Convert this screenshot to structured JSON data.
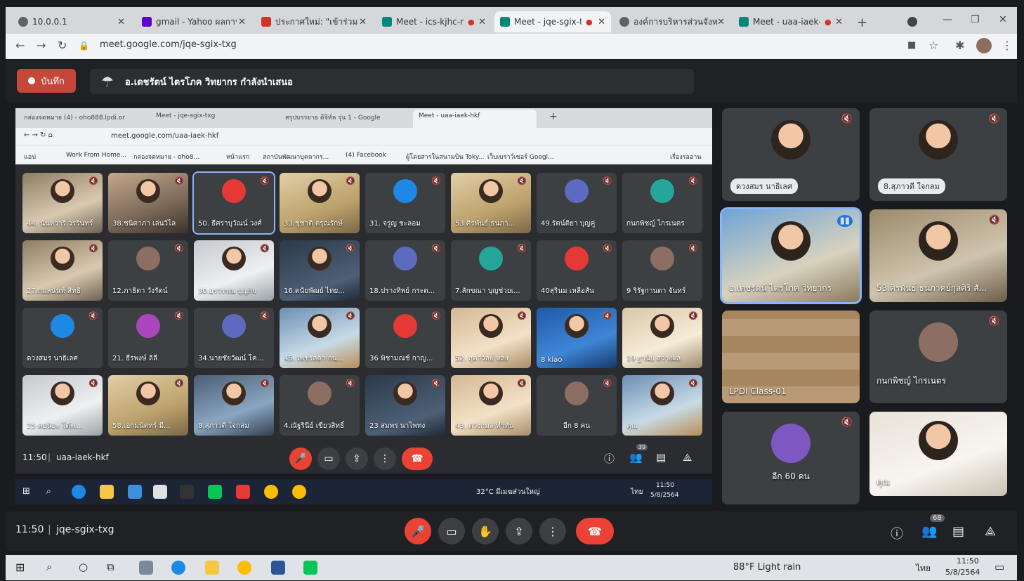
{
  "browser": {
    "tabs": [
      {
        "label": "10.0.0.1",
        "color": "#5f6368"
      },
      {
        "label": "gmail - Yahoo ผลการค้นหา",
        "color": "#6001d2"
      },
      {
        "label": "ประกาศใหม่: \"เข้าร่วมชั้น",
        "color": "#d93025"
      },
      {
        "label": "Meet - ics-kjhc-n",
        "color": "#00897b"
      },
      {
        "label": "Meet - jqe-sgix-t",
        "color": "#00897b"
      },
      {
        "label": "องค์การบริหารส่วนจังหวัด",
        "color": "#5f6368"
      },
      {
        "label": "Meet - uaa-iaek-h",
        "color": "#00897b"
      }
    ],
    "url": "meet.google.com/jqe-sgix-txg"
  },
  "meet_outer": {
    "record_label": "บันทึก",
    "presenting_text": "อ.เดชรัตน์ ไตรโภค วิทยากร กำลังนำเสนอ",
    "time": "11:50",
    "meeting_code": "jqe-sgix-txg",
    "people_count": "68"
  },
  "inner_browser": {
    "tabs": [
      "กล่องจดหมาย (4) - oho888.lpdi.or",
      "Meet - jqe-sgix-txg",
      "สรุปบรรยาย ดิจิทัล รุ่น 1 - Google",
      "Meet - uaa-iaek-hkf"
    ],
    "url": "meet.google.com/uaa-iaek-hkf",
    "bookmarks": [
      "แอป",
      "Work From Home...",
      "กล่องจดหมาย - oho8...",
      "หน้าแรก",
      "สถาบันพัฒนาบุคลากร...",
      "(4) Facebook",
      "ผู้โดยสารในสนามบิน Toky...",
      "เว็บเบราว์เซอร์ Googl...",
      "เรื่องรออ่าน"
    ]
  },
  "inner_grid": [
    {
      "name": "44. นันทวารี วรรินทร์",
      "style": "video1"
    },
    {
      "name": "38.ชนิตาภา เล่นวิไล",
      "style": "video10"
    },
    {
      "name": "50. ธีศราบุวัณน์ วงศ์",
      "style": "avatar"
    },
    {
      "name": "33.ชุชาติ ตรุณรักษ์",
      "style": "video9"
    },
    {
      "name": "31. จรูญ ชะลอม",
      "style": "avatar"
    },
    {
      "name": "53.ศิรพันธ์ ธนภา...",
      "style": "video9"
    },
    {
      "name": "49.รัตน์ติยา บุญคู่",
      "style": "avatar"
    },
    {
      "name": "กนกพิชญ์ ไกรเนตร",
      "style": "avatar"
    },
    {
      "name": "27.กมลนันท์ สิทธิ",
      "style": "video1"
    },
    {
      "name": "12.ภาธิดา วังรัตน์",
      "style": "avatar"
    },
    {
      "name": "30.อรวรรณ บุญกิจ",
      "style": "video2"
    },
    {
      "name": "16.ดนัยพัฒย์ ไทย...",
      "style": "video3"
    },
    {
      "name": "18.ปรางทิพย์ กระต...",
      "style": "avatar"
    },
    {
      "name": "7.ลักขณา บุญช่วยเ...",
      "style": "avatar"
    },
    {
      "name": "40สุรินม เหลือสัน",
      "style": "avatar"
    },
    {
      "name": "9 ริรัฐกานดา จันทร์",
      "style": "avatar"
    },
    {
      "name": "ดวงสมร นาธิเลศ",
      "style": "avatar"
    },
    {
      "name": "21. ธีรพงษ์ ลิลี",
      "style": "avatar"
    },
    {
      "name": "34.นายชัยวัฒน์ โค...",
      "style": "avatar"
    },
    {
      "name": "45. เพชรลดา กน...",
      "style": "video4"
    },
    {
      "name": "36 พิชามณช์ กาญ...",
      "style": "avatar"
    },
    {
      "name": "52. สุดาวัลย์ หลง",
      "style": "video5"
    },
    {
      "name": "8 kiao",
      "style": "video8"
    },
    {
      "name": "19 ฐานิย์ สว่างผล",
      "style": "video7"
    },
    {
      "name": "25 คอนิอะ โด๊ะเ...",
      "style": "video2"
    },
    {
      "name": "58.เอกมนิตทร์ มี...",
      "style": "video9"
    },
    {
      "name": "8.สุภาวดี ใจกล่ม",
      "style": "video6"
    },
    {
      "name": "4.ณัฐรินีย์ เขียวสิทธิ์",
      "style": "avatar"
    },
    {
      "name": "23 สมพร นาไพทง",
      "style": "video3"
    },
    {
      "name": "43. ดวงกมล ทำทัน",
      "style": "video5"
    },
    {
      "name": "อีก 8 คน",
      "style": "more"
    },
    {
      "name": "คุณ",
      "style": "video4"
    }
  ],
  "inner_bottom": {
    "time": "11:50",
    "code": "uaa-iaek-hkf",
    "people_count": "39"
  },
  "inner_taskbar": {
    "weather": "32°C มีเมฆส่วนใหญ่",
    "lang": "ไทย",
    "time": "11:50",
    "date": "5/8/2564"
  },
  "right_panel": [
    {
      "name": "ดวงสมร นาธิเลศ",
      "kind": "chip"
    },
    {
      "name": "8.สุภาวดี ใจกลม",
      "kind": "chip"
    },
    {
      "name": "อ.เดชรัตน์ ไตรโภค วิทยากร",
      "kind": "video-speaker"
    },
    {
      "name": "53.ศิรพันธ์ ธนภาคย์กุลศิริ สั...",
      "kind": "video"
    },
    {
      "name": "LPDI Class-01",
      "kind": "video-room"
    },
    {
      "name": "กนกพิชญ์ ไกรเนตร",
      "kind": "avatar"
    },
    {
      "name": "อีก 60 คน",
      "kind": "more"
    },
    {
      "name": "คุณ",
      "kind": "self"
    }
  ],
  "win_taskbar": {
    "weather": "88°F Light rain",
    "lang": "ไทย",
    "time": "11:50",
    "date": "5/8/2564"
  },
  "colors": {
    "accent_red": "#ea4335",
    "active_speaker": "#8ab4f8",
    "record": "#c5473a"
  }
}
